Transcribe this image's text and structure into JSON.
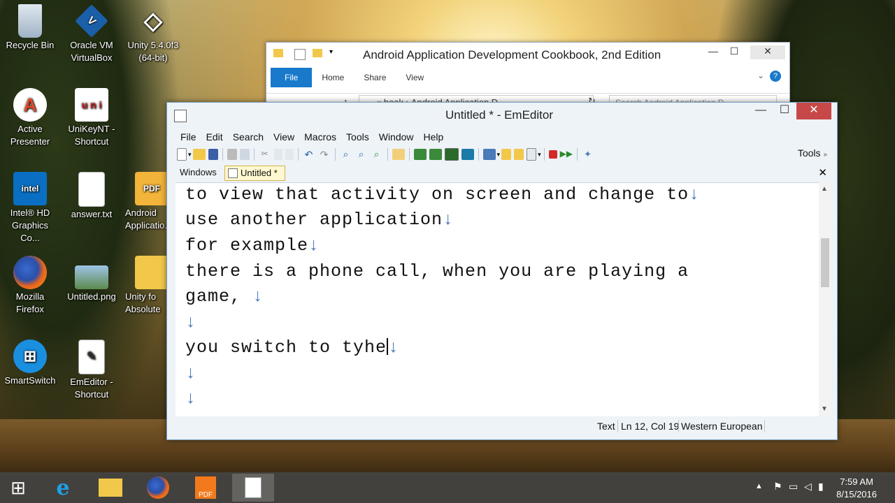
{
  "desktop": {
    "icons": [
      {
        "label": "Recycle Bin",
        "icon": "recycle-bin-icon"
      },
      {
        "label": "Oracle VM VirtualBox",
        "icon": "virtualbox-icon"
      },
      {
        "label": "Unity 5.4.0f3 (64-bit)",
        "icon": "unity-icon"
      },
      {
        "label": "Active Presenter",
        "icon": "activepresenter-icon"
      },
      {
        "label": "UniKeyNT - Shortcut",
        "icon": "unikey-icon"
      },
      {
        "label": "Intel® HD Graphics Co...",
        "icon": "intel-hd-icon"
      },
      {
        "label": "answer.txt",
        "icon": "text-file-icon"
      },
      {
        "label": "Android Applicatio...",
        "icon": "pdf-folder-icon"
      },
      {
        "label": "Mozilla Firefox",
        "icon": "firefox-icon"
      },
      {
        "label": "Untitled.png",
        "icon": "image-file-icon"
      },
      {
        "label": "Unity fo Absolute",
        "icon": "folder-icon"
      },
      {
        "label": "SmartSwitch",
        "icon": "smartswitch-icon"
      },
      {
        "label": "EmEditor - Shortcut",
        "icon": "emeditor-icon"
      }
    ]
  },
  "explorer": {
    "title": "Android Application Development Cookbook, 2nd Edition",
    "tabs": [
      "File",
      "Home",
      "Share",
      "View"
    ],
    "path": "« book › Android Application D...",
    "search_placeholder": "Search Android Application D..."
  },
  "emeditor": {
    "title": "Untitled * - EmEditor",
    "menu": [
      "File",
      "Edit",
      "Search",
      "View",
      "Macros",
      "Tools",
      "Window",
      "Help"
    ],
    "tools_label": "Tools",
    "windows_label": "Windows",
    "tab_label": "Untitled *",
    "lines": [
      "to view that activity on screen and change to",
      "use another application",
      "for example",
      "there is a phone call, when you are playing a",
      "game, ",
      "",
      "you switch to tyhe",
      "",
      ""
    ],
    "newline_symbol": "↓",
    "status": {
      "mode": "Text",
      "position": "Ln 12, Col 19",
      "encoding": "Western European"
    }
  },
  "taskbar": {
    "time": "7:59 AM",
    "date": "8/15/2016"
  },
  "colors": {
    "close_red": "#c74848",
    "explorer_file_tab": "#1979ca",
    "newline_mark": "#4a7ab8"
  }
}
